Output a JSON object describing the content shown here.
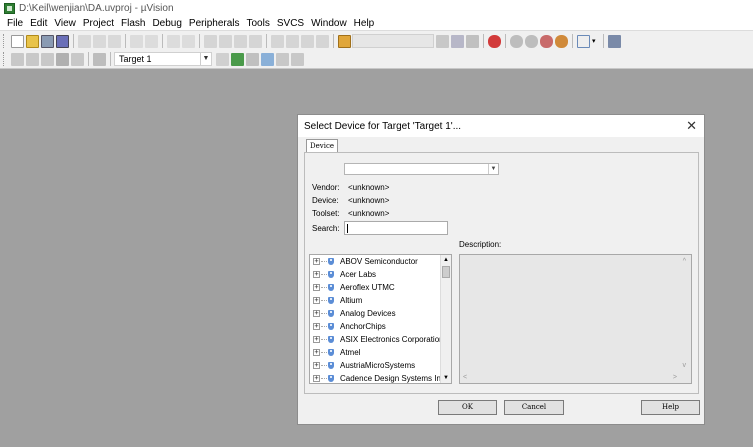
{
  "window": {
    "title": "D:\\Keil\\wenjian\\DA.uvproj - µVision"
  },
  "menubar": {
    "items": [
      "File",
      "Edit",
      "View",
      "Project",
      "Flash",
      "Debug",
      "Peripherals",
      "Tools",
      "SVCS",
      "Window",
      "Help"
    ]
  },
  "toolbar2": {
    "target": "Target 1"
  },
  "dialog": {
    "title": "Select Device for Target 'Target 1'...",
    "close": "✕",
    "tab": "Device",
    "fields": {
      "vendor_label": "Vendor:",
      "vendor_value": "<unknown>",
      "device_label": "Device:",
      "device_value": "<unknown>",
      "toolset_label": "Toolset:",
      "toolset_value": "<unknown>",
      "search_label": "Search:",
      "search_value": ""
    },
    "description_label": "Description:",
    "vendors": [
      "ABOV Semiconductor",
      "Acer Labs",
      "Aeroflex UTMC",
      "Altium",
      "Analog Devices",
      "AnchorChips",
      "ASIX Electronics Corporation",
      "Atmel",
      "AustriaMicroSystems",
      "Cadence Design Systems Inc."
    ],
    "buttons": {
      "ok": "OK",
      "cancel": "Cancel",
      "help": "Help"
    }
  }
}
